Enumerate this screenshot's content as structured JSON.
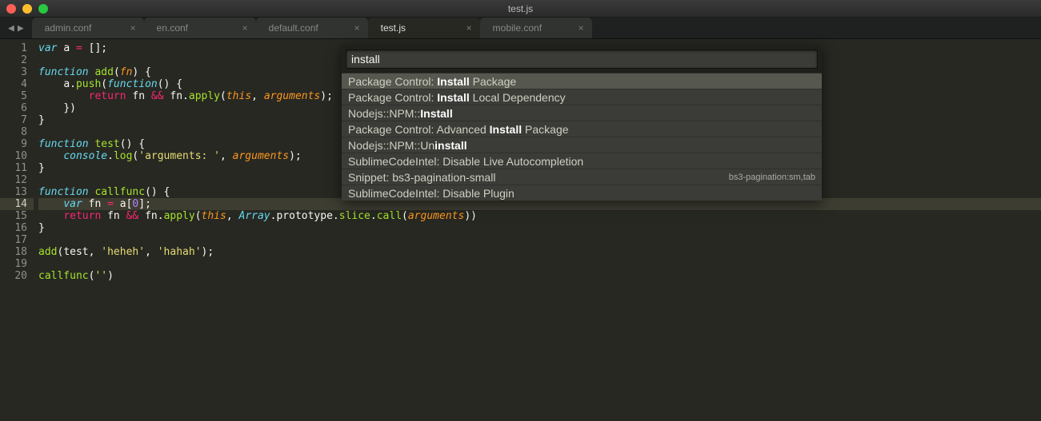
{
  "window": {
    "title": "test.js"
  },
  "tabs": [
    {
      "label": "admin.conf",
      "active": false
    },
    {
      "label": "en.conf",
      "active": false
    },
    {
      "label": "default.conf",
      "active": false
    },
    {
      "label": "test.js",
      "active": true
    },
    {
      "label": "mobile.conf",
      "active": false
    }
  ],
  "gutter": {
    "lines": 20,
    "highlight": 14
  },
  "code": {
    "l1": {
      "kw": "var",
      "sp": " ",
      "id": "a",
      "eq": " = ",
      "br": "[]",
      "sc": ";"
    },
    "l3": {
      "kw": "function",
      "sp": " ",
      "name": "add",
      "paren_open": "(",
      "arg": "fn",
      "paren_close": ")",
      "brace": " {"
    },
    "l4": {
      "indent1": "    ",
      "obj": "a",
      "dot": ".",
      "fn": "push",
      "po": "(",
      "kw": "function",
      "pc": "()",
      "brace": " {"
    },
    "l5": {
      "indent2": "        ",
      "ret": "return",
      "sp": " ",
      "id": "fn",
      "sp2": " ",
      "op": "&&",
      "sp3": " ",
      "id2": "fn",
      "dot": ".",
      "fn": "apply",
      "po": "(",
      "this": "this",
      "comma": ", ",
      "args": "arguments",
      "pc": ");"
    },
    "l6": {
      "indent1": "    ",
      "close": "})"
    },
    "l7": {
      "brace": "}"
    },
    "l9": {
      "kw": "function",
      "sp": " ",
      "name": "test",
      "pc": "()",
      "brace": " {"
    },
    "l10": {
      "indent1": "    ",
      "obj": "console",
      "dot": ".",
      "fn": "log",
      "po": "(",
      "str": "'arguments: '",
      "comma": ", ",
      "args": "arguments",
      "pc": ");"
    },
    "l11": {
      "brace": "}"
    },
    "l13": {
      "kw": "function",
      "sp": " ",
      "name": "callfunc",
      "pc": "()",
      "brace": " {"
    },
    "l14": {
      "indent1": "    ",
      "var": "var",
      "sp": " ",
      "id": "fn",
      "eq": " = ",
      "obj": "a",
      "bo": "[",
      "num": "0",
      "bc": "]",
      "sc": ";"
    },
    "l15": {
      "indent1": "    ",
      "ret": "return",
      "sp": " ",
      "id": "fn",
      "sp2": " ",
      "op": "&&",
      "sp3": " ",
      "id2": "fn",
      "dot": ".",
      "fn": "apply",
      "po": "(",
      "this": "this",
      "comma": ", ",
      "arr": "Array",
      "d2": ".",
      "proto": "prototype",
      "d3": ".",
      "slice": "slice",
      "d4": ".",
      "call": "call",
      "po2": "(",
      "args": "arguments",
      "pc": "))"
    },
    "l16": {
      "brace": "}"
    },
    "l18": {
      "fn": "add",
      "po": "(",
      "a1": "test",
      "c1": ", ",
      "s1": "'heheh'",
      "c2": ", ",
      "s2": "'hahah'",
      "pc": ");"
    },
    "l20": {
      "fn": "callfunc",
      "po": "(",
      "str": "''",
      "pc": ")"
    }
  },
  "palette": {
    "query": "install",
    "items": [
      {
        "pre": "Package Control: ",
        "bold": "Install",
        "post": " Package",
        "selected": true
      },
      {
        "pre": "Package Control: ",
        "bold": "Install",
        "post": " Local Dependency"
      },
      {
        "pre": "Nodejs::NPM::",
        "bold": "Install",
        "post": ""
      },
      {
        "pre": "Package Control: Advanced ",
        "bold": "Install",
        "post": " Package"
      },
      {
        "pre": "Nodejs::NPM::Un",
        "bold": "install",
        "post": ""
      },
      {
        "pre": "SublimeCodeIntel: Disable Live Autocompletion",
        "bold": "",
        "post": ""
      },
      {
        "pre": "Snippet: bs3-pagination-small",
        "bold": "",
        "post": "",
        "hint": "bs3-pagination:sm,tab"
      },
      {
        "pre": "SublimeCodeIntel: Disable Plugin",
        "bold": "",
        "post": ""
      }
    ]
  }
}
